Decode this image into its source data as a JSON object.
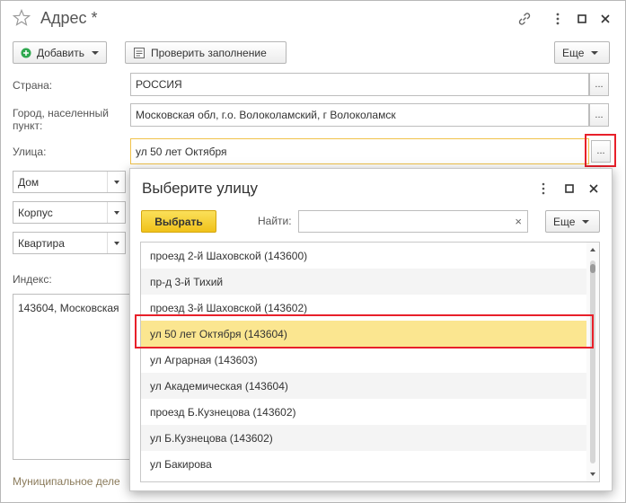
{
  "window": {
    "title": "Адрес *"
  },
  "toolbar": {
    "add_label": "Добавить",
    "check_label": "Проверить заполнение",
    "more_label": "Еще"
  },
  "form": {
    "country_label": "Страна:",
    "country_value": "РОССИЯ",
    "city_label": "Город, населенный пункт:",
    "city_value": "Московская обл, г.о. Волоколамский, г Волоколамск",
    "street_label": "Улица:",
    "street_value": "ул 50 лет Октября",
    "choose_label": "...",
    "house_label": "Дом",
    "building_label": "Корпус",
    "apartment_label": "Квартира",
    "index_label": "Индекс:",
    "presentation_value": "143604, Московская",
    "municipal_label": "Муниципальное деле"
  },
  "popup": {
    "title": "Выберите улицу",
    "select_label": "Выбрать",
    "find_label": "Найти:",
    "search_value": "",
    "clear_label": "×",
    "more_label": "Еще",
    "items": [
      {
        "label": "проезд 2-й Шаховской (143600)"
      },
      {
        "label": "пр-д 3-й Тихий"
      },
      {
        "label": "проезд 3-й Шаховской (143602)"
      },
      {
        "label": "ул 50 лет Октября (143604)"
      },
      {
        "label": "ул Аграрная (143603)"
      },
      {
        "label": "ул Академическая (143604)"
      },
      {
        "label": "проезд Б.Кузнецова (143602)"
      },
      {
        "label": "ул Б.Кузнецова (143602)"
      },
      {
        "label": "ул Бакирова"
      }
    ],
    "selected_index": 3
  },
  "colors": {
    "highlight": "#e8202a",
    "selection": "#fbe690",
    "accent_yellow": "#f0c21a",
    "add_green": "#2fa84f"
  }
}
